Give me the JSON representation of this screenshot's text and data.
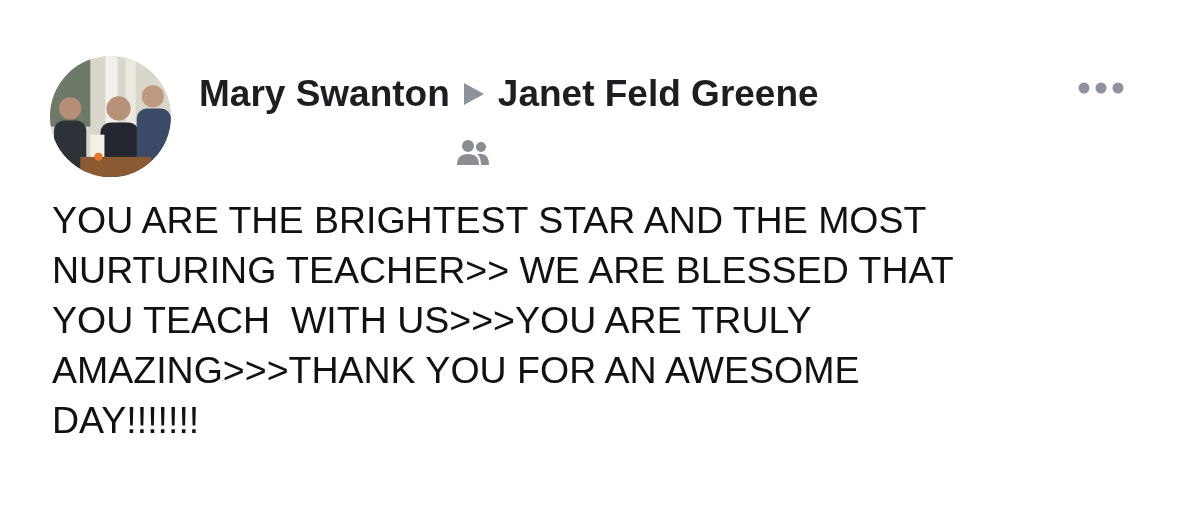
{
  "post": {
    "author": "Mary Swanton",
    "recipient": "Janet Feld Greene",
    "text": "YOU ARE THE BRIGHTEST STAR AND THE MOST\nNURTURING TEACHER>> WE ARE BLESSED THAT\nYOU TEACH  WITH US>>>YOU ARE TRULY\nAMAZING>>>THANK YOU FOR AN AWESOME\nDAY!!!!!!!"
  }
}
